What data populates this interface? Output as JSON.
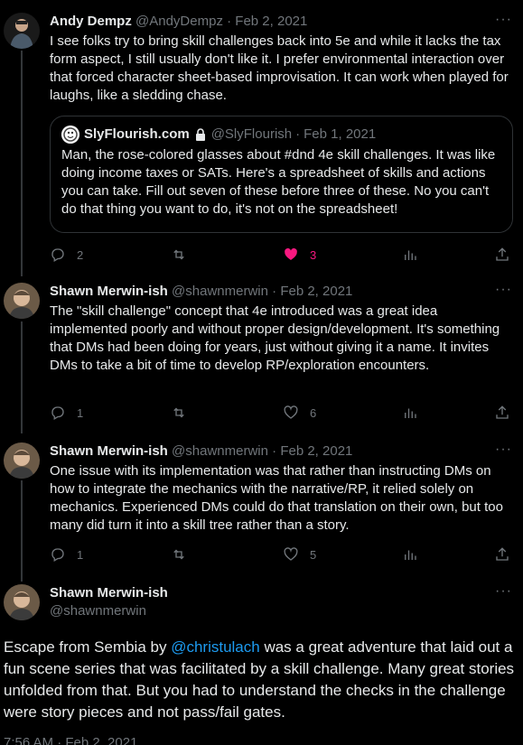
{
  "tweets": [
    {
      "name": "Andy Dempz",
      "handle": "@AndyDempz",
      "date": "Feb 2, 2021",
      "text": "I see folks try to bring skill challenges back into 5e and while it lacks the tax form aspect, I still usually don't like it. I prefer environmental interaction over that forced character sheet-based improvisation. It can work when played for laughs, like a sledding chase.",
      "quote": {
        "name": "SlyFlourish.com",
        "handle": "@SlyFlourish",
        "date": "Feb 1, 2021",
        "text": "Man, the rose-colored glasses about #dnd 4e skill challenges. It was like doing income taxes or SATs. Here's a spreadsheet of skills and actions you can take. Fill out seven of these before three of these. No you can't do that thing you want to do, it's not on the spreadsheet!"
      },
      "replies": "2",
      "retweets": "",
      "likes": "3",
      "liked": true
    },
    {
      "name": "Shawn Merwin-ish",
      "handle": "@shawnmerwin",
      "date": "Feb 2, 2021",
      "text": "The \"skill challenge\" concept that 4e introduced was a great idea implemented poorly and without proper design/development. It's something that DMs had been doing for years, just without giving it a name. It invites DMs to take a bit of time to develop RP/exploration encounters.",
      "replies": "1",
      "retweets": "",
      "likes": "6",
      "liked": false
    },
    {
      "name": "Shawn Merwin-ish",
      "handle": "@shawnmerwin",
      "date": "Feb 2, 2021",
      "text": "One issue with its implementation was that rather than instructing DMs on how to integrate the mechanics with the narrative/RP, it relied solely on mechanics. Experienced DMs could do that translation on their own, but too many did turn it into a skill tree rather than a story.",
      "replies": "1",
      "retweets": "",
      "likes": "5",
      "liked": false
    }
  ],
  "main_tweet": {
    "name": "Shawn Merwin-ish",
    "handle": "@shawnmerwin",
    "text_before": "Escape from Sembia by ",
    "mention": "@christulach",
    "text_after": " was a great adventure that laid out a fun scene series that was facilitated by a skill challenge. Many great stories unfolded from that. But you had to understand the checks in the challenge were story pieces and not pass/fail gates.",
    "timestamp": "7:56 AM · Feb 2, 2021"
  },
  "ui": {
    "separator": "·",
    "more": "···"
  },
  "colors": {
    "background": "#000000",
    "text": "#e7e9ea",
    "muted": "#71767b",
    "link": "#1d9bf0",
    "like": "#f91880",
    "border": "#2f3336"
  }
}
